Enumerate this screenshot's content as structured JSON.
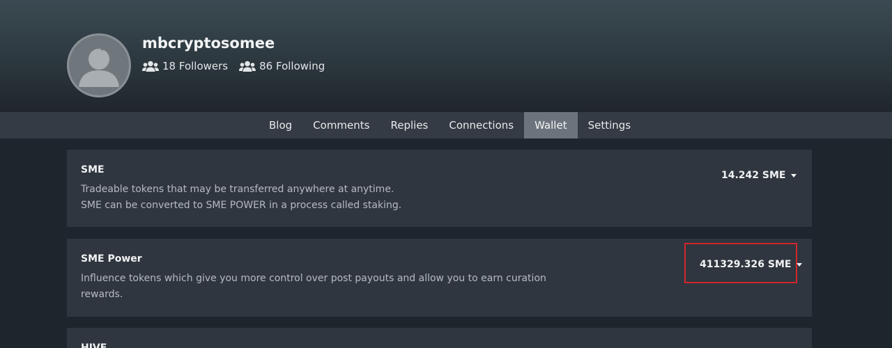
{
  "profile": {
    "username": "mbcryptosomee",
    "followers_label": "18 Followers",
    "following_label": "86 Following"
  },
  "icons": {
    "avatar": "default-user-avatar-icon",
    "followers": "users-icon",
    "following": "users-icon",
    "dropdown": "caret-down-icon"
  },
  "nav": {
    "tabs": [
      {
        "label": "Blog",
        "active": false
      },
      {
        "label": "Comments",
        "active": false
      },
      {
        "label": "Replies",
        "active": false
      },
      {
        "label": "Connections",
        "active": false
      },
      {
        "label": "Wallet",
        "active": true
      },
      {
        "label": "Settings",
        "active": false
      }
    ]
  },
  "wallet": {
    "sme": {
      "title": "SME",
      "desc_line1": "Tradeable tokens that may be transferred anywhere at anytime.",
      "desc_line2": "SME can be converted to SME POWER in a process called staking.",
      "balance": "14.242 SME"
    },
    "sme_power": {
      "title": "SME Power",
      "desc_line1": "Influence tokens which give you more control over post payouts and allow you to earn curation",
      "desc_line2": "rewards.",
      "balance": "411329.326 SME",
      "highlighted": true
    },
    "hive": {
      "title": "HIVE"
    }
  },
  "colors": {
    "highlight": "#d0262c",
    "active_tab": "#6b747c",
    "card": "#30363f",
    "background": "#1f252c"
  }
}
